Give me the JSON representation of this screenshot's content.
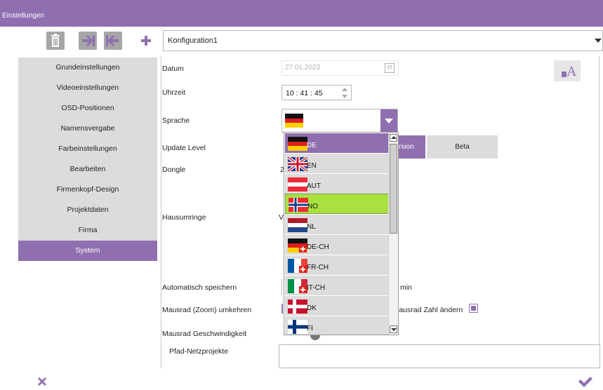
{
  "window": {
    "title": "Einstellungen"
  },
  "toolbar": {
    "icons": [
      "trash-icon",
      "skip-to-end-icon",
      "skip-to-start-icon",
      "plus-icon"
    ],
    "config_value": "Konfiguration1"
  },
  "sidebar": {
    "items": [
      {
        "label": "Grundeinstellungen",
        "active": false
      },
      {
        "label": "Videoeinstellungen",
        "active": false
      },
      {
        "label": "OSD-Positionen",
        "active": false
      },
      {
        "label": "Namensvergabe",
        "active": false
      },
      {
        "label": "Farbeinstellungen",
        "active": false
      },
      {
        "label": "Bearbeiten",
        "active": false
      },
      {
        "label": "Firmenkopf-Design",
        "active": false
      },
      {
        "label": "Projektdaten",
        "active": false
      },
      {
        "label": "Firma",
        "active": false
      },
      {
        "label": "System",
        "active": true
      }
    ]
  },
  "form": {
    "date_label": "Datum",
    "date_value": "27.01.2023",
    "time_label": "Uhrzeit",
    "time_value": "10 : 41 : 45",
    "language_label": "Sprache",
    "update_label": "Update Level",
    "update_option_active": "rsion",
    "update_option_beta": "Beta",
    "dongle_label": "Dongle",
    "dongle_value": "2",
    "house_label": "Hausumringe",
    "house_value": "V",
    "autosave_label": "Automatisch speichern",
    "autosave_unit": "min",
    "zoom_label": "Mausrad (Zoom) umkehren",
    "wheel_count_label": "lausrad Zahl ändern",
    "speed_label": "Mausrad Geschwindigkeit",
    "path_label": "Pfad-Netzprojekte"
  },
  "language_dropdown": {
    "selected": "DE",
    "hovered": "NO",
    "items": [
      {
        "code": "DE",
        "flag": "germany-flag"
      },
      {
        "code": "EN",
        "flag": "uk-flag"
      },
      {
        "code": "AUT",
        "flag": "austria-flag"
      },
      {
        "code": "NO",
        "flag": "norway-flag"
      },
      {
        "code": "NL",
        "flag": "netherlands-flag"
      },
      {
        "code": "DE-CH",
        "flag": "germany-swiss-flag"
      },
      {
        "code": "FR-CH",
        "flag": "france-swiss-flag"
      },
      {
        "code": "IT-CH",
        "flag": "italy-swiss-flag"
      },
      {
        "code": "DK",
        "flag": "denmark-flag"
      },
      {
        "code": "FI",
        "flag": "finland-flag"
      }
    ]
  },
  "footer": {
    "cancel_icon": "close-icon",
    "ok_icon": "checkmark-icon"
  },
  "colors": {
    "accent": "#8f6fb0",
    "sidebar_bg": "#dcdcdc",
    "hover": "#a9e23f"
  }
}
